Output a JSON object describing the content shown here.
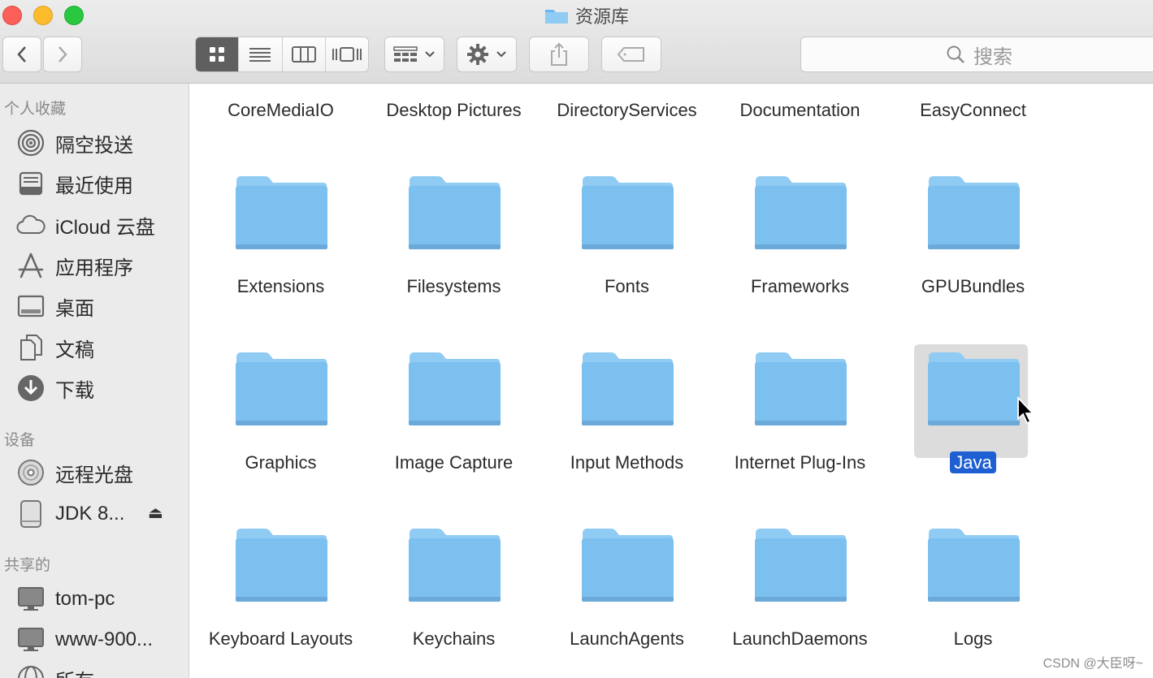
{
  "window": {
    "title": "资源库"
  },
  "toolbar": {
    "back_icon": "chevron-left-icon",
    "forward_icon": "chevron-right-icon",
    "views": [
      "icon-view-icon",
      "list-view-icon",
      "column-view-icon",
      "cover-flow-icon"
    ],
    "arrange_icon": "grid-arrange-icon",
    "action_icon": "gear-icon",
    "share_icon": "share-icon",
    "tag_icon": "tag-icon",
    "search_placeholder": "搜索"
  },
  "sidebar": {
    "favorites_header": "个人收藏",
    "favorites": [
      {
        "label": "隔空投送",
        "icon": "airdrop-icon"
      },
      {
        "label": "最近使用",
        "icon": "recents-icon"
      },
      {
        "label": "iCloud 云盘",
        "icon": "cloud-icon"
      },
      {
        "label": "应用程序",
        "icon": "applications-icon"
      },
      {
        "label": "桌面",
        "icon": "desktop-icon"
      },
      {
        "label": "文稿",
        "icon": "documents-icon"
      },
      {
        "label": "下载",
        "icon": "downloads-icon"
      }
    ],
    "devices_header": "设备",
    "devices": [
      {
        "label": "远程光盘",
        "icon": "disc-icon"
      },
      {
        "label": "JDK 8...",
        "icon": "drive-icon"
      }
    ],
    "eject_symbol": "⏏",
    "shared_header": "共享的",
    "shared": [
      {
        "label": "tom-pc",
        "icon": "computer-icon"
      },
      {
        "label": "www-900...",
        "icon": "computer-icon"
      },
      {
        "label": "所有",
        "icon": "network-icon"
      }
    ]
  },
  "content": {
    "top_row": [
      "CoreMediaIO",
      "Desktop Pictures",
      "DirectoryServices",
      "Documentation",
      "EasyConnect"
    ],
    "rows": [
      [
        "Extensions",
        "Filesystems",
        "Fonts",
        "Frameworks",
        "GPUBundles"
      ],
      [
        "Graphics",
        "Image Capture",
        "Input Methods",
        "Internet Plug-Ins",
        "Java"
      ],
      [
        "Keyboard Layouts",
        "Keychains",
        "LaunchAgents",
        "LaunchDaemons",
        "Logs"
      ]
    ],
    "selected": "Java"
  },
  "colors": {
    "folder": "#7cc0f0",
    "folder_tab": "#8fcbf3",
    "selection": "#1e5fd1"
  },
  "watermark": "CSDN @大臣呀~"
}
